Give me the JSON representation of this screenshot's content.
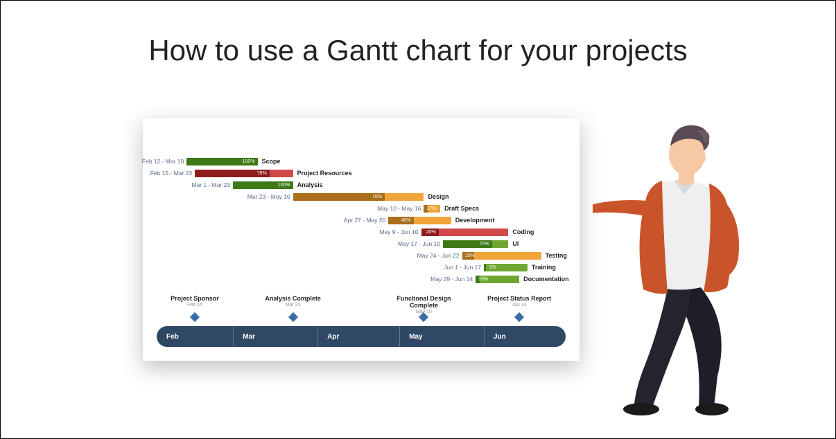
{
  "title": "How to use a Gantt chart for your projects",
  "chart_data": {
    "type": "gantt",
    "time_range": {
      "start": "Feb 1",
      "end": "Jul 1"
    },
    "months": [
      "Feb",
      "Mar",
      "Apr",
      "May",
      "Jun"
    ],
    "tasks": [
      {
        "name": "Scope",
        "range": "Feb 12 - Mar 10",
        "start": 11,
        "end": 37,
        "pct": 100,
        "track_color": "#6fa632",
        "progress_color": "#3d7a15"
      },
      {
        "name": "Project Resources",
        "range": "Feb 15 - Mar 23",
        "start": 14,
        "end": 50,
        "pct": 76,
        "track_color": "#d04848",
        "progress_color": "#8f1d1d"
      },
      {
        "name": "Analysis",
        "range": "Mar 1 - Mar 23",
        "start": 28,
        "end": 50,
        "pct": 100,
        "track_color": "#6fa632",
        "progress_color": "#3d7a15"
      },
      {
        "name": "Design",
        "range": "Mar 23 - May 10",
        "start": 50,
        "end": 98,
        "pct": 70,
        "track_color": "#f0a53a",
        "progress_color": "#a96e1a"
      },
      {
        "name": "Draft Specs",
        "range": "May 10 - May 16",
        "start": 98,
        "end": 104,
        "pct": 27,
        "track_color": "#f0a53a",
        "progress_color": "#a96e1a"
      },
      {
        "name": "Development",
        "range": "Apr 27 - May 20",
        "start": 85,
        "end": 108,
        "pct": 40,
        "track_color": "#f0a53a",
        "progress_color": "#a96e1a"
      },
      {
        "name": "Coding",
        "range": "May 9 - Jun 10",
        "start": 97,
        "end": 129,
        "pct": 20,
        "track_color": "#d04848",
        "progress_color": "#8f1d1d"
      },
      {
        "name": "UI",
        "range": "May 17 - Jun 10",
        "start": 105,
        "end": 129,
        "pct": 75,
        "track_color": "#6fa632",
        "progress_color": "#3d7a15"
      },
      {
        "name": "Testing",
        "range": "May 24 - Jun 22",
        "start": 112,
        "end": 141,
        "pct": 15,
        "track_color": "#f0a53a",
        "progress_color": "#a96e1a"
      },
      {
        "name": "Training",
        "range": "Jun 1 - Jun 17",
        "start": 120,
        "end": 136,
        "pct": 5,
        "track_color": "#6fa632",
        "progress_color": "#3d7a15"
      },
      {
        "name": "Documentation",
        "range": "May 29 - Jun 14",
        "start": 117,
        "end": 133,
        "pct": 10,
        "track_color": "#6fa632",
        "progress_color": "#3d7a15"
      }
    ],
    "milestones": [
      {
        "name": "Project Sponsor",
        "date": "Feb 15",
        "day": 14
      },
      {
        "name": "Analysis Complete",
        "date": "Mar 23",
        "day": 50
      },
      {
        "name": "Functional Design Complete",
        "date": "May 10",
        "day": 98
      },
      {
        "name": "Project Status Report",
        "date": "Jun 14",
        "day": 133
      }
    ],
    "axis_days": 150
  },
  "colors": {
    "axis_bg": "#2f4864",
    "diamond": "#3a6da8",
    "person_jacket": "#c9542a",
    "person_shirt": "#efefef",
    "person_pants": "#1e1e28",
    "person_skin": "#f6c9a4",
    "person_hair": "#5a4a55",
    "person_shoe": "#1b1b1b"
  }
}
